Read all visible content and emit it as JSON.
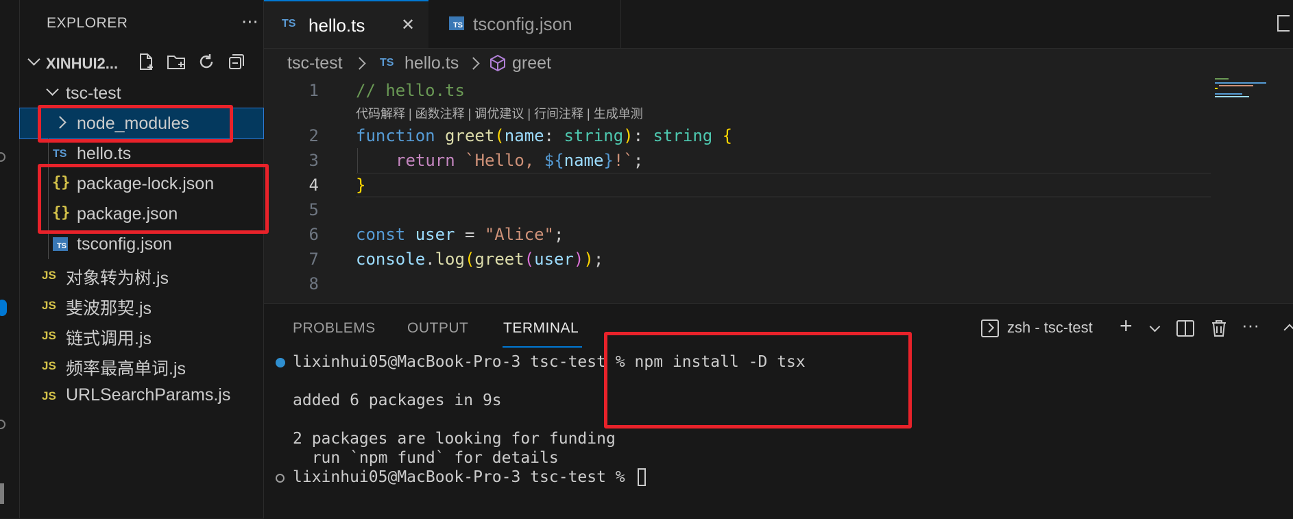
{
  "sidebar": {
    "title": "EXPLORER",
    "more": "···",
    "root": "XINHUI2...",
    "items": [
      {
        "label": "tsc-test"
      },
      {
        "label": "node_modules"
      },
      {
        "label": "hello.ts",
        "icon": "TS"
      },
      {
        "label": "package-lock.json",
        "icon": "{}"
      },
      {
        "label": "package.json",
        "icon": "{}"
      },
      {
        "label": "tsconfig.json",
        "icon": "TS"
      },
      {
        "label": "对象转为树.js",
        "icon": "JS"
      },
      {
        "label": "斐波那契.js",
        "icon": "JS"
      },
      {
        "label": "链式调用.js",
        "icon": "JS"
      },
      {
        "label": "频率最高单词.js",
        "icon": "JS"
      },
      {
        "label": "URLSearchParams.js",
        "icon": "JS"
      }
    ]
  },
  "tabs": [
    {
      "label": "hello.ts",
      "icon": "TS",
      "close": "✕"
    },
    {
      "label": "tsconfig.json",
      "icon": "TS"
    }
  ],
  "breadcrumb": {
    "folder": "tsc-test",
    "file_icon": "TS",
    "file": "hello.ts",
    "symbol": "greet"
  },
  "editor": {
    "line_numbers": [
      "1",
      "2",
      "3",
      "4",
      "5",
      "6",
      "7",
      "8"
    ],
    "codelens": "代码解释 | 函数注释 | 调优建议 | 行间注释 | 生成单测",
    "lines": {
      "l1": "// hello.ts",
      "l2_kw": "function",
      "l2_fn": "greet",
      "l2_paren_open": "(",
      "l2_param": "name",
      "l2_colon": ": ",
      "l2_type": "string",
      "l2_paren_close": ")",
      "l2_ret": ": ",
      "l2_rettype": "string",
      "l2_brace": " {",
      "l3_kw": "return",
      "l3_str1": "`Hello, ",
      "l3_interp_open": "${",
      "l3_var": "name",
      "l3_interp_close": "}",
      "l3_str2": "!`",
      "l3_semi": ";",
      "l4": "}",
      "l6_kw": "const",
      "l6_var": "user",
      "l6_eq": " = ",
      "l6_str": "\"Alice\"",
      "l6_semi": ";",
      "l7_obj": "console",
      "l7_dot": ".",
      "l7_fn": "log",
      "l7_p1": "(",
      "l7_fn2": "greet",
      "l7_p2": "(",
      "l7_var": "user",
      "l7_p3": ")",
      "l7_p4": ")",
      "l7_semi": ";"
    }
  },
  "panel": {
    "tabs": [
      "PROBLEMS",
      "OUTPUT",
      "TERMINAL"
    ],
    "active_tab": "TERMINAL",
    "terminal_name": "zsh - tsc-test",
    "add": "+",
    "more": "···",
    "terminal": {
      "prompt1": "lixinhui05@MacBook-Pro-3 tsc-test % npm install -D tsx",
      "out1": "added 6 packages in 9s",
      "out2": "2 packages are looking for funding",
      "out3": "  run `npm fund` for details",
      "prompt2": "lixinhui05@MacBook-Pro-3 tsc-test % "
    }
  },
  "colors": {
    "highlight_box": "#e8222a",
    "accent": "#0078d4",
    "selection": "#04395e"
  }
}
